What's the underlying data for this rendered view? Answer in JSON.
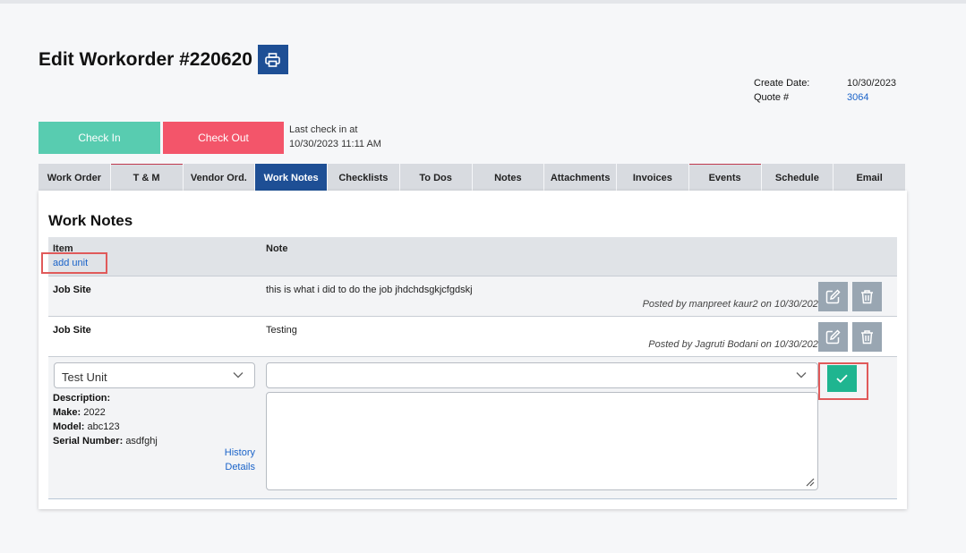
{
  "header": {
    "title": "Edit Workorder #220620",
    "create_date_label": "Create Date:",
    "create_date_value": "10/30/2023",
    "quote_label": "Quote #",
    "quote_value": "3064"
  },
  "actions": {
    "check_in_label": "Check In",
    "check_out_label": "Check Out",
    "last_check_label": "Last check in at",
    "last_check_value": "10/30/2023 11:11 AM"
  },
  "tabs": [
    {
      "label": "Work Order"
    },
    {
      "label": "T & M"
    },
    {
      "label": "Vendor Ord."
    },
    {
      "label": "Work Notes"
    },
    {
      "label": "Checklists"
    },
    {
      "label": "To Dos"
    },
    {
      "label": "Notes"
    },
    {
      "label": "Attachments"
    },
    {
      "label": "Invoices"
    },
    {
      "label": "Events"
    },
    {
      "label": "Schedule"
    },
    {
      "label": "Email"
    }
  ],
  "active_tab": "Work Notes",
  "work_notes": {
    "title": "Work Notes",
    "col_item": "Item",
    "col_note": "Note",
    "add_unit_label": "add unit",
    "rows": [
      {
        "item": "Job Site",
        "note": "this is what i did to do the job jhdchdsgkjcfgdskj",
        "posted": "Posted by manpreet kaur2 on 10/30/2023"
      },
      {
        "item": "Job Site",
        "note": "Testing",
        "posted": "Posted by Jagruti Bodani on 10/30/2023"
      }
    ],
    "edit": {
      "unit_value": "Test Unit",
      "description_label": "Description:",
      "description_value": "",
      "make_label": "Make:",
      "make_value": "2022",
      "model_label": "Model:",
      "model_value": "abc123",
      "serial_label": "Serial Number:",
      "serial_value": "asdfghj",
      "history_link": "History",
      "details_link": "Details",
      "note_select_value": "",
      "note_text": ""
    }
  },
  "colors": {
    "primary": "#1e4f95",
    "check_in": "#58ccb0",
    "check_out": "#f3556a",
    "confirm": "#1fb590",
    "link": "#1a63c9",
    "highlight": "#e05a5a"
  },
  "icons": {
    "print": "printer-icon",
    "edit": "edit-icon",
    "delete": "trash-icon",
    "confirm": "check-icon",
    "dropdown": "chevron-down-icon"
  }
}
